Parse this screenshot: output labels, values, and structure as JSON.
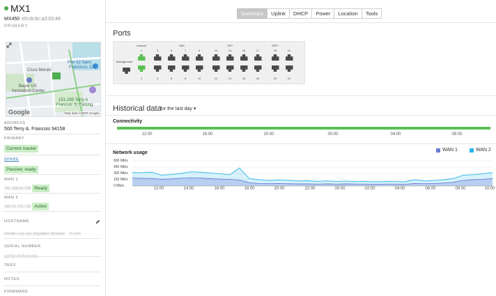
{
  "device": {
    "name": "MX1",
    "model": "MX450",
    "mac": "e0:cb:bc:a3:03:48",
    "role": "PRIMARY",
    "status_color": "#4aad4a"
  },
  "map": {
    "labels": [
      "Pier 52 Sans",
      "Francisco, CA",
      "Cisco Meraki",
      "Bayer US",
      "Innovation Center",
      "151-299 Terry A",
      "Francois St Parking"
    ],
    "brand": "Google",
    "attribution": "Map data ©2020 Google"
  },
  "info": {
    "address_label": "ADDRESS",
    "address": "500 Terry A. Francois 94158",
    "primary_label": "PRIMARY",
    "primary_status": "Current master",
    "spare_label": "SPARE",
    "spare_status": "Passive; ready",
    "wan1_label": "WAN 1",
    "wan1_ip": "192.168.83.208",
    "wan1_status": "Ready",
    "wan2_label": "WAN 2",
    "wan2_ip": "184.23.135.143",
    "wan2_status": "Active",
    "hostname_label": "HOSTNAME",
    "hostname_line1": "meraki-corp-vpn-dnjydpkm.dynamic-",
    "hostname_line2": "m.com",
    "serial_label": "SERIAL NUMBER",
    "serial": "Q2TW-7679-WHKA",
    "tags_label": "TAGS",
    "notes_label": "NOTES",
    "firmware_label": "FIRMWARE"
  },
  "tabs": [
    "Summary",
    "Uplink",
    "DHCP",
    "Power",
    "Location",
    "Tools"
  ],
  "ports": {
    "title": "Ports",
    "group_labels": [
      "Internet",
      "GbE",
      "SFP",
      "SFP+"
    ],
    "management_label": "Management",
    "top_numbers": [
      "1",
      "3",
      "5",
      "7",
      "9",
      "11",
      "13",
      "15",
      "17",
      "19",
      "21",
      "23",
      "25"
    ],
    "bottom_numbers": [
      "2",
      "4",
      "6",
      "8",
      "10",
      "12",
      "14",
      "16",
      "18",
      "20",
      "22",
      "24",
      "25"
    ],
    "up_ports": [
      1,
      2,
      23
    ],
    "up_color": "#5bbf53"
  },
  "historical": {
    "title": "Historical data",
    "range": "for the last day ▾",
    "connectivity_title": "Connectivity",
    "connectivity_color": "#5bbf53",
    "conn_ticks": [
      "12:00",
      "16:00",
      "20:00",
      "00:00",
      "04:00",
      "08:00"
    ]
  },
  "network_usage": {
    "title": "Network usage",
    "legend": [
      {
        "name": "WAN 1",
        "color": "#6b7fd6"
      },
      {
        "name": "WAN 2",
        "color": "#29b6e8"
      }
    ]
  },
  "chart_data": {
    "type": "area",
    "title": "Network usage",
    "xlabel": "",
    "ylabel": "",
    "y_ticks": [
      "600 Mb/s",
      "450 Mb/s",
      "300 Mb/s",
      "150 Mb/s",
      "0 Mb/s"
    ],
    "x_ticks": [
      "12:00",
      "14:00",
      "16:00",
      "18:00",
      "20:00",
      "22:00",
      "00:00",
      "02:00",
      "04:00",
      "06:00",
      "08:00",
      "10:00"
    ],
    "ylim": [
      0,
      600
    ],
    "series": [
      {
        "name": "WAN 1",
        "values": [
          190,
          185,
          180,
          160,
          170,
          185,
          195,
          190,
          175,
          165,
          160,
          140,
          80,
          60,
          55,
          60,
          55,
          50,
          50,
          45,
          50,
          45,
          50,
          45,
          45,
          40,
          45,
          45,
          40,
          60,
          55,
          60,
          70,
          90,
          130,
          150,
          160,
          180
        ]
      },
      {
        "name": "WAN 2",
        "values": [
          320,
          320,
          330,
          260,
          275,
          300,
          340,
          330,
          310,
          290,
          270,
          430,
          180,
          150,
          130,
          140,
          135,
          120,
          125,
          110,
          120,
          110,
          115,
          105,
          110,
          100,
          110,
          105,
          100,
          150,
          120,
          130,
          150,
          180,
          260,
          270,
          290,
          320
        ]
      }
    ]
  }
}
